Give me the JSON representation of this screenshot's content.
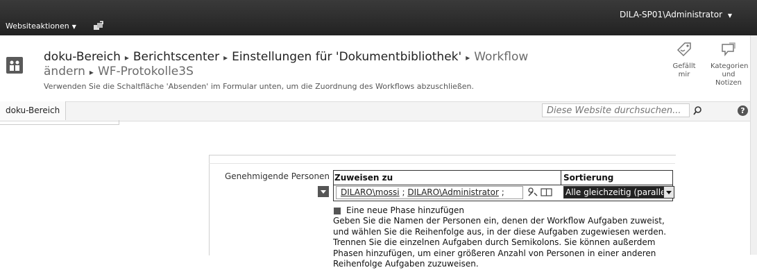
{
  "topbar": {
    "site_actions_label": "Websiteaktionen",
    "site_actions_caret": "▼",
    "user_label": "DILA-SP01\\Administrator",
    "user_caret": "▼"
  },
  "header": {
    "breadcrumb": [
      "doku-Bereich",
      "Berichtscenter",
      "Einstellungen für 'Dokumentbibliothek'",
      "Workflow ändern",
      "WF-Protokolle3S"
    ],
    "separator": "▸",
    "description": "Verwenden Sie die Schaltfläche 'Absenden' im Formular unten, um die Zuordnung des Workflows abzuschließen."
  },
  "ribbon": {
    "like_label": "Gefällt mir",
    "tags_label": "Kategorien und Notizen"
  },
  "toolbar": {
    "tab_label": "doku-Bereich",
    "search_placeholder": "Diese Website durchsuchen...",
    "help_glyph": "?"
  },
  "form": {
    "field_label": "Genehmigende Personen",
    "col_assign": "Zuweisen zu",
    "col_order": "Sortierung",
    "people": [
      "DILARO\\mossi",
      "DILARO\\Administrator"
    ],
    "people_separator": " ; ",
    "order_value": "Alle gleichzeitig (parallel)",
    "add_phase_label": "Eine neue Phase hinzufügen",
    "help_text": "Geben Sie die Namen der Personen ein, denen der Workflow Aufgaben zuweist, und wählen Sie die Reihenfolge aus, in der diese Aufgaben zugewiesen werden. Trennen Sie die einzelnen Aufgaben durch Semikolons. Sie können außerdem Phasen hinzufügen, um einer größeren Anzahl von Personen in einer anderen Reihenfolge Aufgaben zuzuweisen."
  },
  "colors": {
    "topbar_bg": "#2b2b2b",
    "selected_bg": "#222222"
  }
}
